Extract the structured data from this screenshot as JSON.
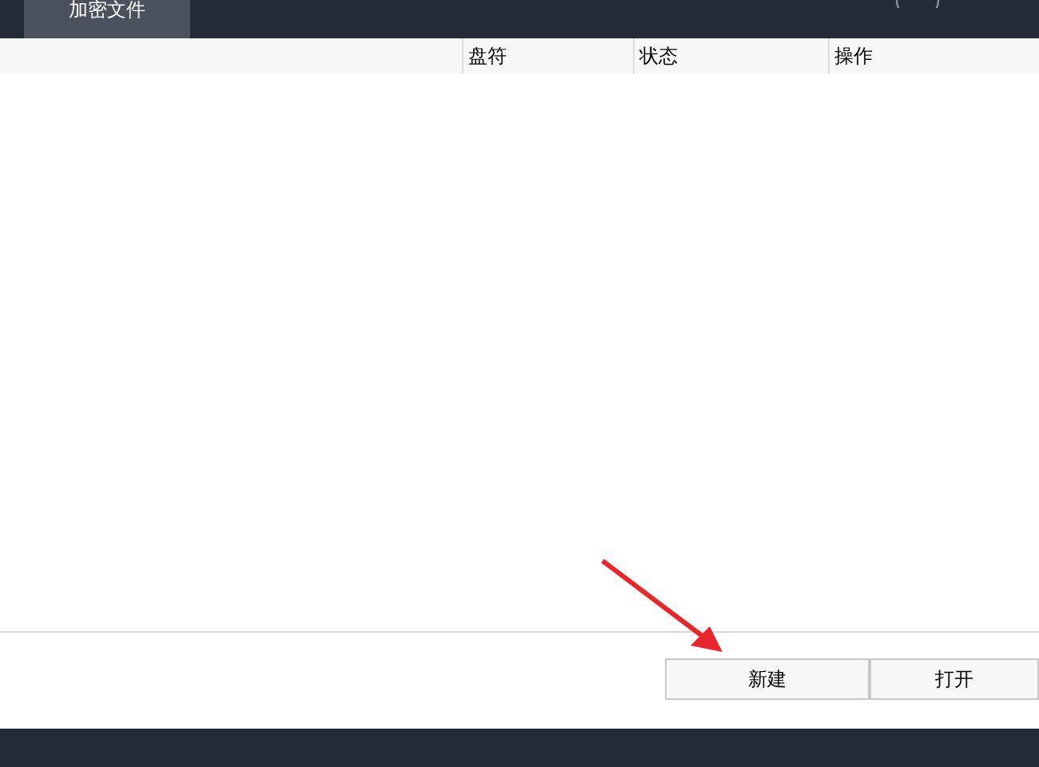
{
  "tabs": [
    {
      "label": "加密文件",
      "selected": true
    }
  ],
  "table": {
    "columns": [
      "",
      "盘符",
      "状态",
      "操作"
    ]
  },
  "buttons": [
    "新建",
    "打开"
  ]
}
